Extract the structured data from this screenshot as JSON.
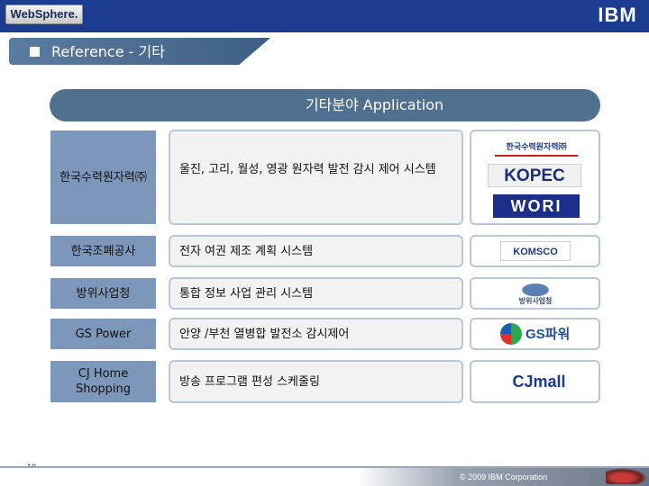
{
  "header": {
    "product_logo": "WebSphere.",
    "company_logo": "IBM"
  },
  "slide": {
    "title": "Reference - 기타",
    "category": "기타분야 Application"
  },
  "rows": [
    {
      "org": "한국수력원자력㈜",
      "task": "울진, 고리, 월성, 영광 원자력 발전 감시 제어 시스템",
      "logos": [
        "한국수력원자력㈜",
        "KOPEC",
        "WORI"
      ]
    },
    {
      "org": "한국조폐공사",
      "task": "전자 여권 제조 계획 시스템",
      "logos": [
        "KOMSCO"
      ]
    },
    {
      "org": "방위사업청",
      "task": "통합 정보 사업 관리 시스템",
      "logos": [
        "방위사업청"
      ]
    },
    {
      "org": "GS Power",
      "task": "안양 /부천 열병합 발전소 감시제어",
      "logos": [
        "GS파워"
      ]
    },
    {
      "org": "CJ Home Shopping",
      "task": "방송 프로그램 편성 스케줄링",
      "logos": [
        "CJmall"
      ]
    }
  ],
  "footer": {
    "page": "19",
    "copyright": "© 2009 IBM Corporation"
  },
  "colors": {
    "brand_bar": "#1c3d8f",
    "header_pill": "#50708f",
    "org_cell": "#7d97ba"
  }
}
